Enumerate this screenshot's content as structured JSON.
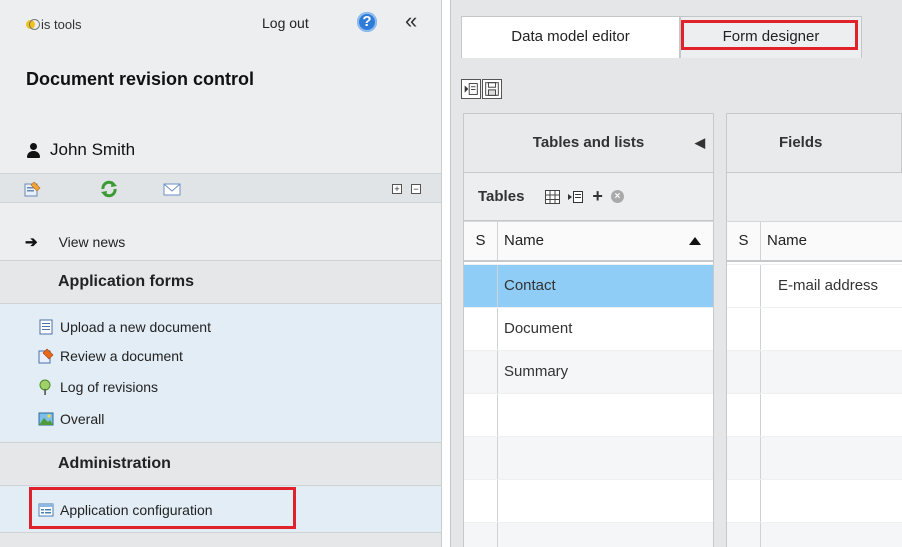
{
  "sidebar": {
    "logo_text": "is tools",
    "logout_label": "Log out",
    "help_icon": "question-circle-icon",
    "collapse_label": "«",
    "app_title": "Document revision control",
    "user_name": "John Smith",
    "plus_label": "+",
    "minus_label": "−",
    "news_label": "View news",
    "sections": [
      {
        "title": "Application forms",
        "items": [
          {
            "label": "Upload a new document",
            "icon": "document-icon"
          },
          {
            "label": "Review a document",
            "icon": "edit-document-icon"
          },
          {
            "label": "Log of revisions",
            "icon": "pin-icon"
          },
          {
            "label": "Overall",
            "icon": "image-icon"
          }
        ]
      },
      {
        "title": "Administration",
        "items": [
          {
            "label": "Application configuration",
            "icon": "config-form-icon"
          }
        ]
      }
    ]
  },
  "main": {
    "tabs": [
      {
        "label": "Data model editor",
        "active": true
      },
      {
        "label": "Form designer",
        "active": false
      }
    ],
    "left_pane": {
      "title": "Tables and lists",
      "collapse_arrow": "◀",
      "tables_label": "Tables",
      "tool_plus": "+",
      "header_s": "S",
      "header_name": "Name",
      "rows": [
        "Contact",
        "Document",
        "Summary"
      ]
    },
    "right_pane": {
      "title": "Fields",
      "header_s": "S",
      "header_name": "Name",
      "rows": [
        "E-mail address"
      ]
    }
  },
  "colors": {
    "highlight": "#e0232b",
    "selected_row": "#8fcdf7",
    "help_blue": "#2f7cd8"
  }
}
